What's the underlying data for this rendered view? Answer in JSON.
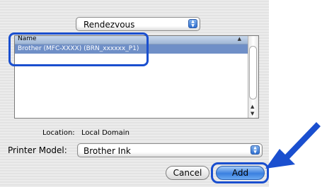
{
  "browse": {
    "selected": "Rendezvous"
  },
  "printer_list": {
    "column_header": "Name",
    "rows": [
      {
        "name": "Brother (MFC-XXXX) (BRN_xxxxxx_P1)"
      }
    ]
  },
  "location": {
    "label": "Location:",
    "value": "Local Domain"
  },
  "printer_model": {
    "label": "Printer Model:",
    "selected": "Brother Ink"
  },
  "buttons": {
    "cancel": "Cancel",
    "add": "Add"
  },
  "icons": {
    "popup_arrows": "up-down-arrows-icon",
    "sort": "sort-ascending-icon",
    "scroll_up": "scroll-up-icon",
    "scroll_down": "scroll-down-icon",
    "pointer": "blue-pointer-arrow-icon"
  },
  "colors": {
    "highlight": "#1a4fcf",
    "selection": "#6f8fc7",
    "default_button": "#3a80e0"
  }
}
